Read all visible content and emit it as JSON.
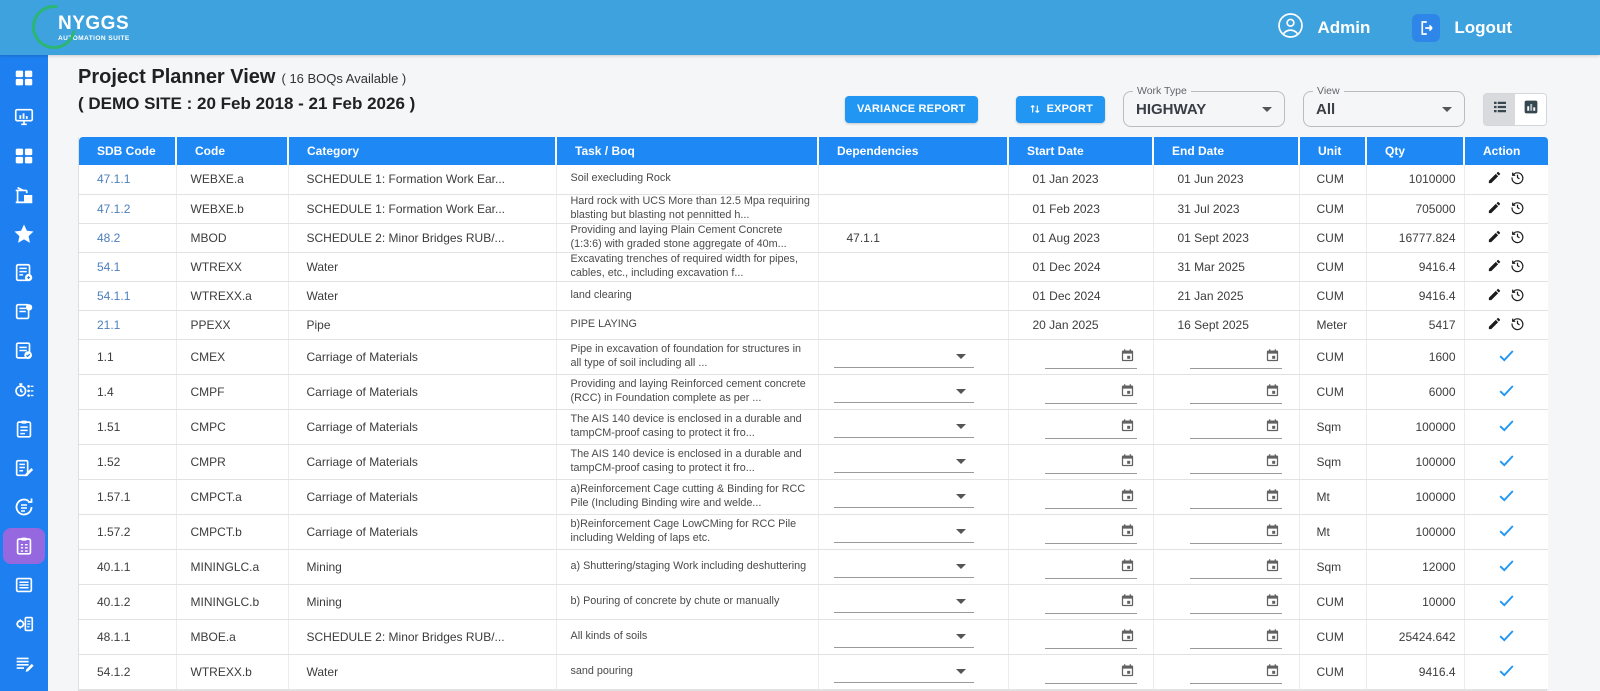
{
  "colors": {
    "topbar_blue": "#3da2de",
    "sidebar_blue": "#1e80f0",
    "header_blue": "#1e88f5",
    "accent_blue": "#2196f3",
    "active_purple": "#9668e0",
    "brand_green": "#2bb673",
    "link_blue": "#4d7fbd"
  },
  "topbar": {
    "brand": {
      "name": "NYGGS",
      "tagline": "AUTOMATION SUITE"
    },
    "user_label": "Admin",
    "logout_label": "Logout"
  },
  "sidebar": {
    "items": [
      {
        "icon": "dashboard-grid-icon",
        "active": false
      },
      {
        "icon": "monitor-analytics-icon",
        "active": false
      },
      {
        "icon": "apps-grid-icon",
        "active": false
      },
      {
        "icon": "crane-icon",
        "active": false
      },
      {
        "icon": "star-icon",
        "active": false
      },
      {
        "icon": "report-calc-icon",
        "active": false
      },
      {
        "icon": "doc-badge-icon",
        "active": false
      },
      {
        "icon": "checklist-check-icon",
        "active": false
      },
      {
        "icon": "stopwatch-flow-icon",
        "active": false
      },
      {
        "icon": "clipboard-list-icon",
        "active": false
      },
      {
        "icon": "doc-edit-icon",
        "active": false
      },
      {
        "icon": "sync-tasks-icon",
        "active": false
      },
      {
        "icon": "planner-clipboard-icon",
        "active": true
      },
      {
        "icon": "list-lines-icon",
        "active": false
      },
      {
        "icon": "gear-doc-icon",
        "active": false
      },
      {
        "icon": "doc-pen-icon",
        "active": false
      }
    ]
  },
  "page": {
    "title": "Project Planner View",
    "boq_note": "( 16 BOQs Available )",
    "site_note": "( DEMO SITE : 20 Feb 2018 - 21 Feb 2026 )"
  },
  "toolbar": {
    "variance_report_label": "VARIANCE REPORT",
    "export_label": "EXPORT",
    "work_type_label": "Work Type",
    "work_type_value": "HIGHWAY",
    "view_label": "View",
    "view_value": "All"
  },
  "table": {
    "columns": [
      "SDB Code",
      "Code",
      "Category",
      "Task / Boq",
      "Dependencies",
      "Start Date",
      "End Date",
      "Unit",
      "Qty",
      "Action"
    ],
    "rows": [
      {
        "sdb": "47.1.1",
        "link": true,
        "code": "WEBXE.a",
        "category": "SCHEDULE 1: Formation Work Ear...",
        "task": "Soil execluding Rock",
        "dependency": "",
        "start": "01 Jan 2023",
        "end": "01 Jun 2023",
        "unit": "CUM",
        "qty": "1010000",
        "editable": false
      },
      {
        "sdb": "47.1.2",
        "link": true,
        "code": "WEBXE.b",
        "category": "SCHEDULE 1: Formation Work Ear...",
        "task": "Hard rock with UCS More than 12.5 Mpa requiring blasting but blasting not pennitted h...",
        "dependency": "",
        "start": "01 Feb 2023",
        "end": "31 Jul 2023",
        "unit": "CUM",
        "qty": "705000",
        "editable": false
      },
      {
        "sdb": "48.2",
        "link": true,
        "code": "MBOD",
        "category": "SCHEDULE 2: Minor Bridges RUB/...",
        "task": "Providing and laying Plain Cement Concrete (1:3:6) with graded stone aggregate of 40m...",
        "dependency": "47.1.1",
        "start": "01 Aug 2023",
        "end": "01 Sept 2023",
        "unit": "CUM",
        "qty": "16777.824",
        "editable": false
      },
      {
        "sdb": "54.1",
        "link": true,
        "code": "WTREXX",
        "category": "Water",
        "task": "Excavating trenches of required width for pipes, cables, etc., including excavation f...",
        "dependency": "",
        "start": "01 Dec 2024",
        "end": "31 Mar 2025",
        "unit": "CUM",
        "qty": "9416.4",
        "editable": false
      },
      {
        "sdb": "54.1.1",
        "link": true,
        "code": "WTREXX.a",
        "category": "Water",
        "task": "land clearing",
        "dependency": "",
        "start": "01 Dec 2024",
        "end": "21 Jan 2025",
        "unit": "CUM",
        "qty": "9416.4",
        "editable": false
      },
      {
        "sdb": "21.1",
        "link": true,
        "code": "PPEXX",
        "category": "Pipe",
        "task": "PIPE LAYING",
        "dependency": "",
        "start": "20 Jan 2025",
        "end": "16 Sept 2025",
        "unit": "Meter",
        "qty": "5417",
        "editable": false
      },
      {
        "sdb": "1.1",
        "link": false,
        "code": "CMEX",
        "category": "Carriage of Materials",
        "task": "Pipe in excavation of foundation for structures in all type of soil including all ...",
        "dependency": "",
        "start": "",
        "end": "",
        "unit": "CUM",
        "qty": "1600",
        "editable": true
      },
      {
        "sdb": "1.4",
        "link": false,
        "code": "CMPF",
        "category": "Carriage of Materials",
        "task": "Providing and laying Reinforced cement concrete (RCC) in Foundation complete as per ...",
        "dependency": "",
        "start": "",
        "end": "",
        "unit": "CUM",
        "qty": "6000",
        "editable": true
      },
      {
        "sdb": "1.51",
        "link": false,
        "code": "CMPC",
        "category": "Carriage of Materials",
        "task": "The AIS 140 device is enclosed in a durable and tampCM-proof casing to protect it fro...",
        "dependency": "",
        "start": "",
        "end": "",
        "unit": "Sqm",
        "qty": "100000",
        "editable": true
      },
      {
        "sdb": "1.52",
        "link": false,
        "code": "CMPR",
        "category": "Carriage of Materials",
        "task": "The AIS 140 device is enclosed in a durable and tampCM-proof casing to protect it fro...",
        "dependency": "",
        "start": "",
        "end": "",
        "unit": "Sqm",
        "qty": "100000",
        "editable": true
      },
      {
        "sdb": "1.57.1",
        "link": false,
        "code": "CMPCT.a",
        "category": "Carriage of Materials",
        "task": "a)Reinforcement Cage cutting & Binding for RCC Pile (Including Binding wire and welde...",
        "dependency": "",
        "start": "",
        "end": "",
        "unit": "Mt",
        "qty": "100000",
        "editable": true
      },
      {
        "sdb": "1.57.2",
        "link": false,
        "code": "CMPCT.b",
        "category": "Carriage of Materials",
        "task": "b)Reinforcement Cage LowCMing for RCC Pile including Welding of laps etc.",
        "dependency": "",
        "start": "",
        "end": "",
        "unit": "Mt",
        "qty": "100000",
        "editable": true
      },
      {
        "sdb": "40.1.1",
        "link": false,
        "code": "MININGLC.a",
        "category": "Mining",
        "task": "a) Shuttering/staging Work including deshuttering",
        "dependency": "",
        "start": "",
        "end": "",
        "unit": "Sqm",
        "qty": "12000",
        "editable": true
      },
      {
        "sdb": "40.1.2",
        "link": false,
        "code": "MININGLC.b",
        "category": "Mining",
        "task": "b) Pouring of concrete by chute or manually",
        "dependency": "",
        "start": "",
        "end": "",
        "unit": "CUM",
        "qty": "10000",
        "editable": true
      },
      {
        "sdb": "48.1.1",
        "link": false,
        "code": "MBOE.a",
        "category": "SCHEDULE 2: Minor Bridges RUB/...",
        "task": "All kinds of soils",
        "dependency": "",
        "start": "",
        "end": "",
        "unit": "CUM",
        "qty": "25424.642",
        "editable": true
      },
      {
        "sdb": "54.1.2",
        "link": false,
        "code": "WTREXX.b",
        "category": "Water",
        "task": "sand pouring",
        "dependency": "",
        "start": "",
        "end": "",
        "unit": "CUM",
        "qty": "9416.4",
        "editable": true
      }
    ]
  }
}
